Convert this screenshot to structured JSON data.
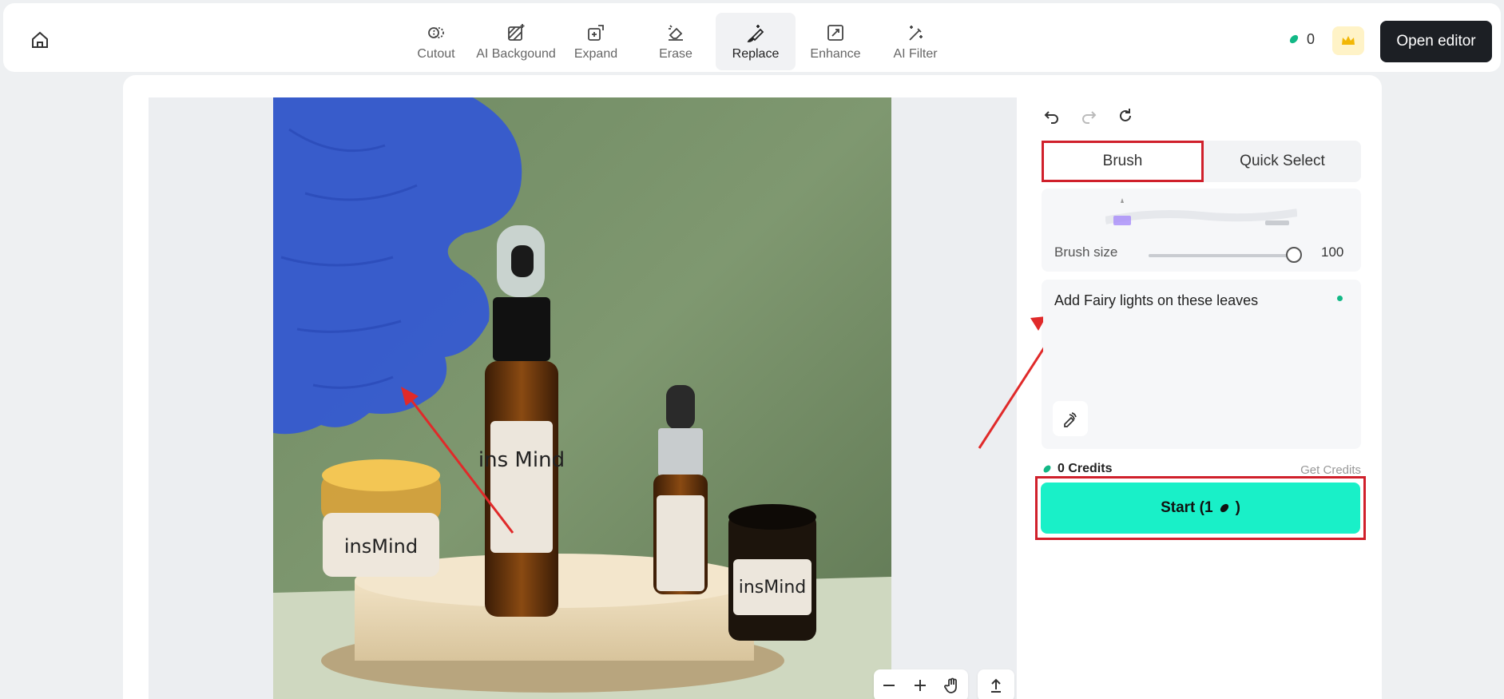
{
  "toolbar": {
    "tools": [
      {
        "label": "Cutout",
        "icon": "cutout-icon"
      },
      {
        "label": "AI Backgound",
        "icon": "ai-background-icon"
      },
      {
        "label": "Expand",
        "icon": "expand-icon"
      },
      {
        "label": "Erase",
        "icon": "erase-icon"
      },
      {
        "label": "Replace",
        "icon": "replace-icon",
        "active": true
      },
      {
        "label": "Enhance",
        "icon": "enhance-icon"
      },
      {
        "label": "AI Filter",
        "icon": "ai-filter-icon"
      }
    ],
    "credit_count": "0",
    "open_editor_label": "Open editor"
  },
  "panel": {
    "tabs": {
      "brush": "Brush",
      "quick_select": "Quick Select"
    },
    "brush_size_label": "Brush size",
    "brush_size_value": "100",
    "brush_size_fraction": 1.0,
    "prompt_value": "Add Fairy lights on these leaves",
    "credits_label": "0 Credits",
    "get_credits_label": "Get Credits",
    "start_label": "Start (1",
    "start_suffix": ")"
  },
  "photo": {
    "labels": {
      "big_bottle": "ins Mind",
      "jar_left": "insMind",
      "jar_right": "insMind"
    }
  },
  "colors": {
    "accent": "#19f0c8",
    "annotation": "#d0202b",
    "mask": "#3358d4",
    "credit_gem": "#12b886"
  }
}
